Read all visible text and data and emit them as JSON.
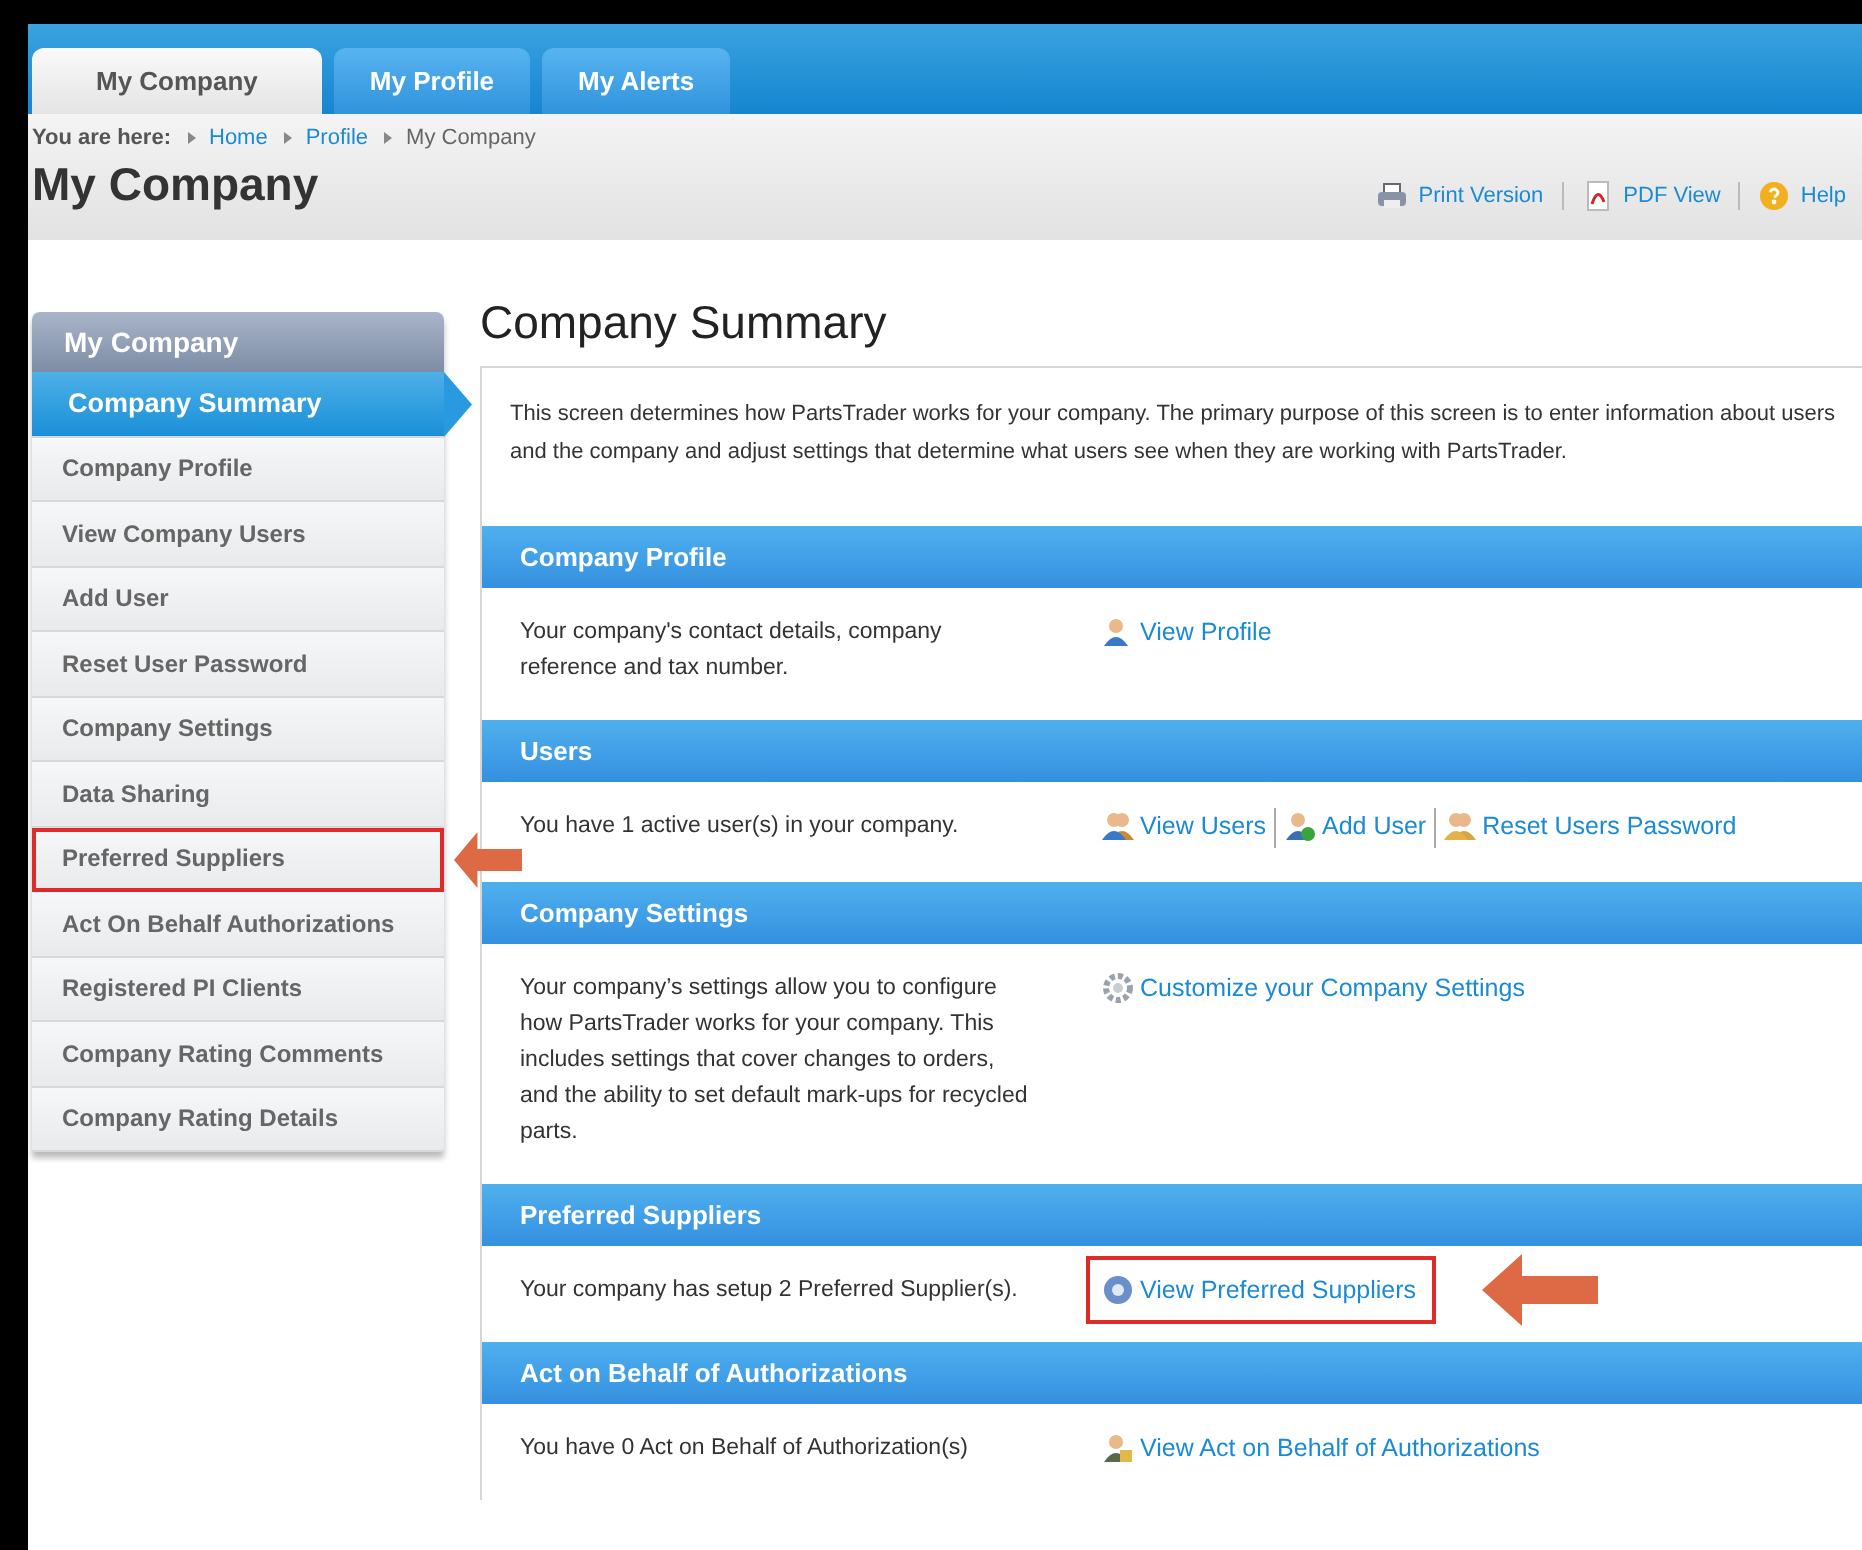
{
  "tabs": [
    {
      "label": "My Company",
      "selected": true
    },
    {
      "label": "My Profile",
      "selected": false
    },
    {
      "label": "My Alerts",
      "selected": false
    }
  ],
  "breadcrumb": {
    "label": "You are here:",
    "items": [
      {
        "label": "Home",
        "link": true
      },
      {
        "label": "Profile",
        "link": true
      },
      {
        "label": "My Company",
        "link": false
      }
    ]
  },
  "page_title": "My Company",
  "tools": [
    {
      "kind": "print",
      "label": "Print Version"
    },
    {
      "kind": "pdf",
      "label": "PDF View"
    },
    {
      "kind": "help",
      "label": "Help"
    }
  ],
  "sidebar": {
    "title": "My Company",
    "items": [
      {
        "label": "Company Summary",
        "selected": true,
        "highlighted": false
      },
      {
        "label": "Company Profile",
        "selected": false,
        "highlighted": false
      },
      {
        "label": "View Company Users",
        "selected": false,
        "highlighted": false
      },
      {
        "label": "Add User",
        "selected": false,
        "highlighted": false
      },
      {
        "label": "Reset User Password",
        "selected": false,
        "highlighted": false
      },
      {
        "label": "Company Settings",
        "selected": false,
        "highlighted": false
      },
      {
        "label": "Data Sharing",
        "selected": false,
        "highlighted": false
      },
      {
        "label": "Preferred Suppliers",
        "selected": false,
        "highlighted": true
      },
      {
        "label": "Act On Behalf Authorizations",
        "selected": false,
        "highlighted": false
      },
      {
        "label": "Registered PI Clients",
        "selected": false,
        "highlighted": false
      },
      {
        "label": "Company Rating Comments",
        "selected": false,
        "highlighted": false
      },
      {
        "label": "Company Rating Details",
        "selected": false,
        "highlighted": false
      }
    ]
  },
  "main": {
    "title": "Company Summary",
    "intro": "This screen determines how PartsTrader works for your company. The primary purpose of this screen is to enter information about users and the company and adjust settings that determine what users see when they are working with PartsTrader.",
    "sections": [
      {
        "title": "Company Profile",
        "description": "Your company's contact details, company reference and tax number.",
        "links": [
          {
            "kind": "profile",
            "label": "View Profile",
            "highlighted": false
          }
        ]
      },
      {
        "title": "Users",
        "description": "You have 1 active user(s) in your company.",
        "links": [
          {
            "kind": "users",
            "label": "View Users",
            "highlighted": false
          },
          {
            "kind": "add-user",
            "label": "Add User",
            "highlighted": false
          },
          {
            "kind": "reset-password",
            "label": "Reset Users Password",
            "highlighted": false
          }
        ]
      },
      {
        "title": "Company Settings",
        "description": "Your company’s settings allow you to configure how PartsTrader works for your company. This includes settings that cover changes to orders, and the ability to set default mark-ups for recycled parts.",
        "links": [
          {
            "kind": "settings",
            "label": "Customize your Company Settings",
            "highlighted": false
          }
        ]
      },
      {
        "title": "Preferred Suppliers",
        "description": "Your company has setup 2 Preferred Supplier(s).",
        "links": [
          {
            "kind": "suppliers",
            "label": "View Preferred Suppliers",
            "highlighted": true
          }
        ]
      },
      {
        "title": "Act on Behalf of Authorizations",
        "description": "You have 0 Act on Behalf of Authorization(s)",
        "links": [
          {
            "kind": "authorizations",
            "label": "View Act on Behalf of Authorizations",
            "highlighted": false
          }
        ]
      }
    ]
  }
}
